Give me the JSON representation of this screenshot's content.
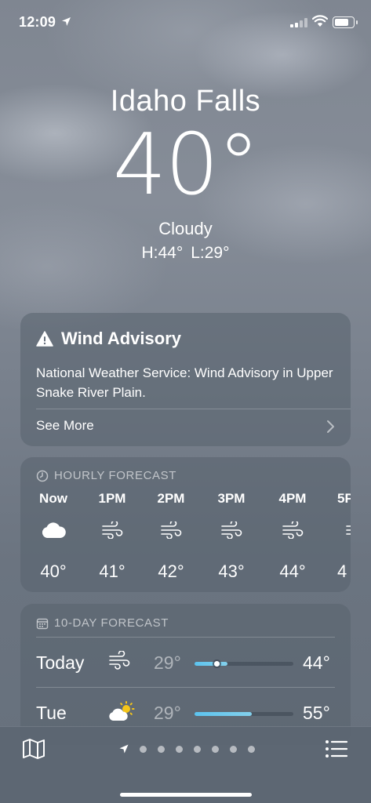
{
  "status_bar": {
    "time": "12:09"
  },
  "hero": {
    "city": "Idaho Falls",
    "temperature": "40°",
    "condition": "Cloudy",
    "high": "H:44°",
    "low": "L:29°"
  },
  "alert": {
    "title": "Wind Advisory",
    "body": "National Weather Service: Wind Advisory in Upper Snake River Plain.",
    "see_more": "See More"
  },
  "hourly": {
    "label": "HOURLY FORECAST",
    "items": [
      {
        "time": "Now",
        "icon": "cloud-icon",
        "temp": "40°"
      },
      {
        "time": "1PM",
        "icon": "wind-icon",
        "temp": "41°"
      },
      {
        "time": "2PM",
        "icon": "wind-icon",
        "temp": "42°"
      },
      {
        "time": "3PM",
        "icon": "wind-icon",
        "temp": "43°"
      },
      {
        "time": "4PM",
        "icon": "wind-icon",
        "temp": "44°"
      },
      {
        "time": "5P",
        "icon": "wind-icon",
        "temp": "4"
      }
    ]
  },
  "daily": {
    "label": "10-DAY FORECAST",
    "days": [
      {
        "day": "Today",
        "icon": "wind-icon",
        "low": "29°",
        "high": "44°",
        "range_start": 0.0,
        "range_end": 0.33,
        "current": 0.23
      },
      {
        "day": "Tue",
        "icon": "partly-sunny-icon",
        "low": "29°",
        "high": "55°",
        "range_start": 0.0,
        "range_end": 0.58
      }
    ]
  },
  "bottom_bar": {
    "pages": 7,
    "current_page": "current-location"
  },
  "colors": {
    "temp_bar": "#5cc3ee",
    "card_background": "rgba(88,98,110,0.55)"
  }
}
